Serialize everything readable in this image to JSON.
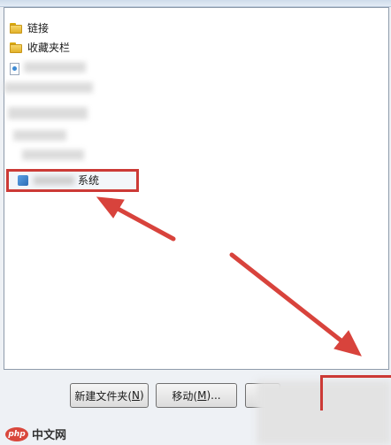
{
  "list": {
    "items": [
      {
        "label": "链接",
        "icon": "folder-icon"
      },
      {
        "label": "收藏夹栏",
        "icon": "folder-icon"
      }
    ],
    "selected_item_label": "系统"
  },
  "buttons": {
    "new_folder": {
      "label": "新建文件夹(",
      "hotkey": "N",
      "suffix": ")"
    },
    "move": {
      "label": "移动(",
      "hotkey": "M",
      "suffix": ")..."
    }
  },
  "watermark": {
    "logo": "php",
    "text": "中文网"
  },
  "colors": {
    "annotation_red": "#cc3a36",
    "folder_yellow": "#f7d769"
  }
}
